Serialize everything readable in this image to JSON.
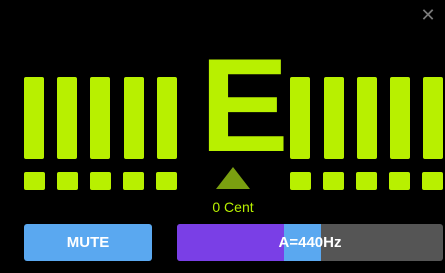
{
  "tuner": {
    "note": "E",
    "cents_label": "0 Cent",
    "colors": {
      "accent": "#b8f000",
      "background": "#000000"
    }
  },
  "controls": {
    "close_icon": "close-icon",
    "mute_label": "MUTE",
    "reference_label": "A=440Hz",
    "colors": {
      "mute_bg": "#5aa8f0",
      "slider_fill": "#7a3fe6",
      "slider_thumb": "#5aa8f0",
      "slider_track": "#555555"
    }
  }
}
